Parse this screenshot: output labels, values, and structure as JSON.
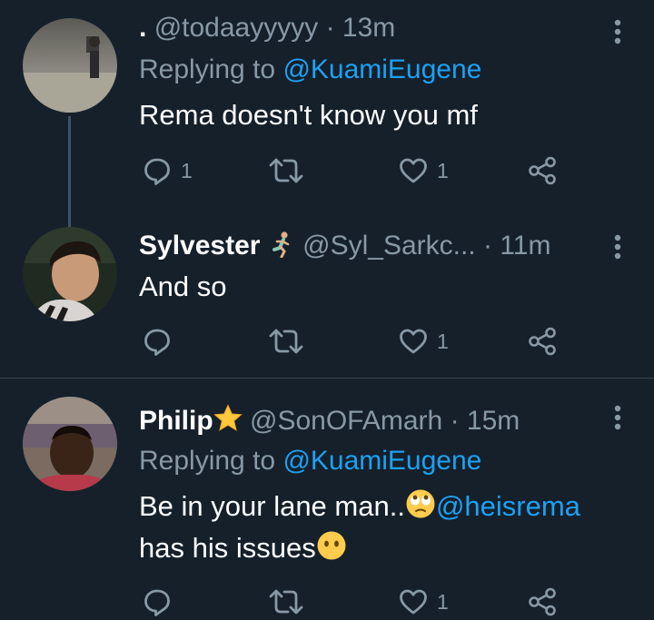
{
  "tweets": [
    {
      "display_name": ".",
      "handle": "@todaayyyyy",
      "time": "· 13m",
      "replying_prefix": "Replying to",
      "replying_to": "@KuamiEugene",
      "text": "Rema doesn't know you mf",
      "reply_count": "1",
      "retweet_count": "",
      "like_count": "1"
    },
    {
      "display_name": "Sylvester",
      "name_emoji": "person-running-emoji",
      "handle": "@Syl_Sarkc...",
      "time": "· 11m",
      "text": "And so",
      "reply_count": "",
      "retweet_count": "",
      "like_count": "1"
    },
    {
      "display_name": "Philip",
      "name_emoji": "star-emoji",
      "handle": "@SonOFAmarh",
      "time": "· 15m",
      "replying_prefix": "Replying to",
      "replying_to": "@KuamiEugene",
      "text_line1": "Be in your lane man..",
      "text_emoji1": "face-with-rolling-eyes-emoji",
      "text_mention": "@heisrema",
      "text_line2": "has his issues",
      "text_emoji2": "face-without-mouth-emoji",
      "reply_count": "",
      "retweet_count": "",
      "like_count": "1"
    }
  ],
  "colors": {
    "background": "#15202b",
    "secondary_text": "#8899a6",
    "link": "#1da1f2",
    "divider": "#38444d",
    "thread_line": "#3d5466"
  }
}
